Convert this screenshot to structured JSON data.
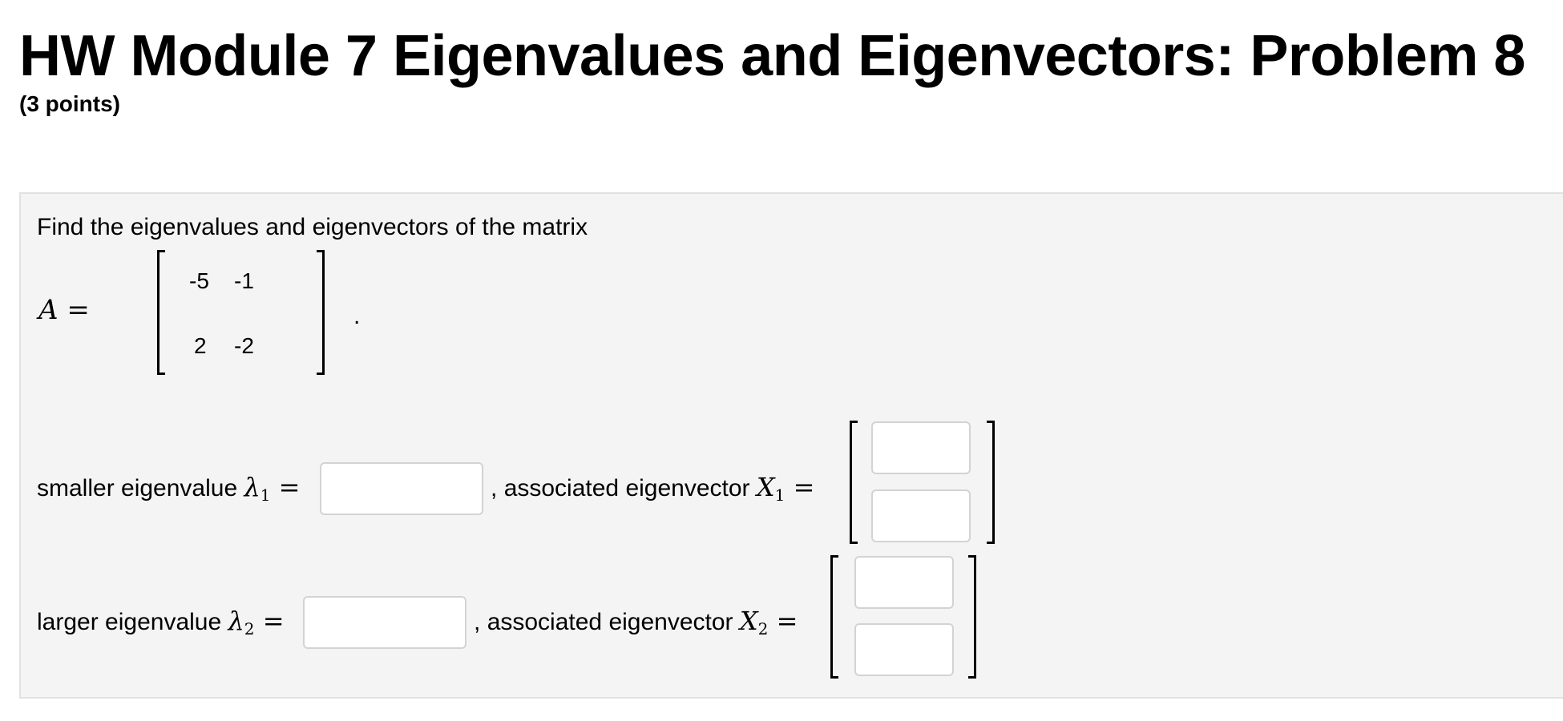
{
  "header": {
    "title": "HW Module 7 Eigenvalues and Eigenvectors: Problem 8",
    "points": "(3 points)"
  },
  "problem": {
    "prompt": "Find the eigenvalues and eigenvectors of the matrix",
    "matrix_label": "A",
    "equals": "=",
    "matrix": {
      "r1c1": "-5",
      "r1c2": "-1",
      "r2c1": "2",
      "r2c2": "-2"
    },
    "period": "."
  },
  "row1": {
    "label": "smaller eigenvalue",
    "symbol": "λ",
    "subscript": "1",
    "equals": "=",
    "eigenvalue_value": "",
    "comma": ",",
    "vector_label": "associated eigenvector",
    "vector_symbol": "X",
    "vector_subscript": "1",
    "vector_equals": "=",
    "vector_top_value": "",
    "vector_bottom_value": ""
  },
  "row2": {
    "label": "larger eigenvalue",
    "symbol": "λ",
    "subscript": "2",
    "equals": "=",
    "eigenvalue_value": "",
    "comma": ",",
    "vector_label": "associated eigenvector",
    "vector_symbol": "X",
    "vector_subscript": "2",
    "vector_equals": "=",
    "vector_top_value": "",
    "vector_bottom_value": ""
  }
}
